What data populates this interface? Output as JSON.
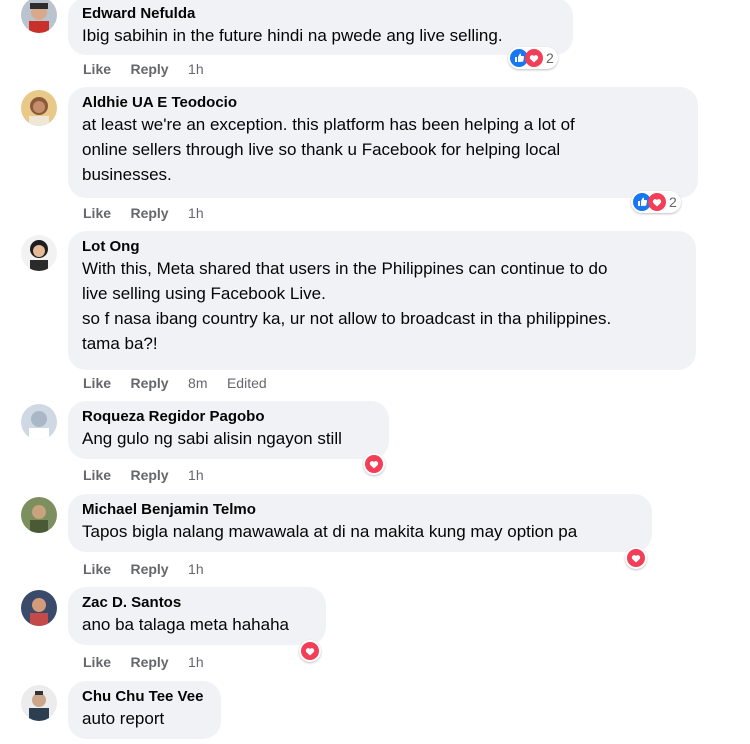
{
  "actions": {
    "like_label": "Like",
    "reply_label": "Reply",
    "edited_label": "Edited"
  },
  "colors": {
    "bubble": "#f0f2f5",
    "meta": "#65676b",
    "like_blue": "#1877f2",
    "love_red": "#f33e58"
  },
  "comments": [
    {
      "author": "Edward Nefulda",
      "text": "Ibig sabihin in the future hindi na pwede ang live selling.",
      "time": "1h",
      "reaction_count": "2",
      "reactions": [
        "like-icon",
        "love-icon"
      ]
    },
    {
      "author": "Aldhie UA E Teodocio",
      "text": "at least we're an exception. this platform has been helping a lot of\nonline sellers through live so thank u Facebook for helping local\nbusinesses.",
      "time": "1h",
      "reaction_count": "2",
      "reactions": [
        "like-icon",
        "love-icon"
      ]
    },
    {
      "author": "Lot Ong",
      "text": "With this, Meta shared that users in the Philippines can continue to do\nlive selling using Facebook Live.\nso f nasa ibang country ka, ur not allow to broadcast in tha philippines.\ntama ba?!",
      "time": "8m",
      "edited": "Edited"
    },
    {
      "author": "Roqueza Regidor Pagobo",
      "text": "Ang gulo ng sabi alisin ngayon still",
      "time": "1h",
      "reactions": [
        "love-icon"
      ]
    },
    {
      "author": "Michael Benjamin Telmo",
      "text": "Tapos bigla nalang mawawala at di na makita kung may option pa",
      "time": "1h",
      "reactions": [
        "love-icon"
      ]
    },
    {
      "author": "Zac D. Santos",
      "text": "ano ba talaga meta hahaha",
      "time": "1h",
      "reactions": [
        "love-icon"
      ]
    },
    {
      "author": "Chu Chu Tee Vee",
      "text": "auto report"
    }
  ]
}
